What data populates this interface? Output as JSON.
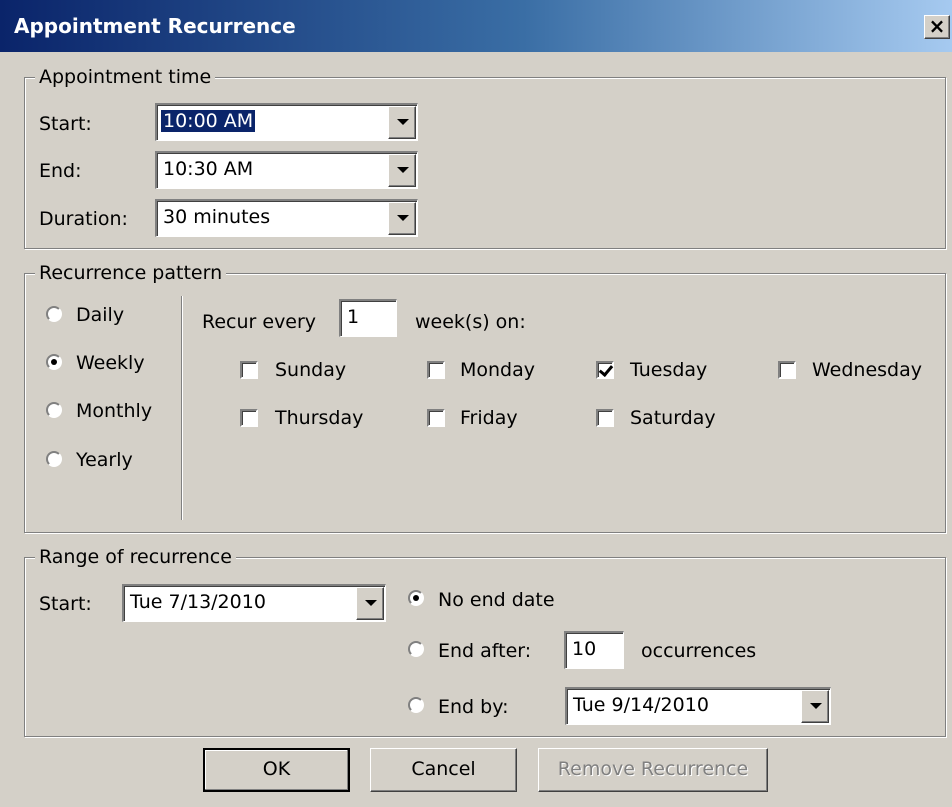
{
  "window": {
    "title": "Appointment Recurrence",
    "close_glyph": "×"
  },
  "appointment_time": {
    "legend": "Appointment time",
    "start_label": "Start:",
    "start_value": "10:00 AM",
    "end_label": "End:",
    "end_value": "10:30 AM",
    "duration_label": "Duration:",
    "duration_value": "30 minutes"
  },
  "recurrence_pattern": {
    "legend": "Recurrence pattern",
    "options": [
      "Daily",
      "Weekly",
      "Monthly",
      "Yearly"
    ],
    "selected": "Weekly",
    "recur_every_label": "Recur every",
    "recur_every_value": "1",
    "weeks_on_label": "week(s) on:",
    "days": [
      {
        "label": "Sunday",
        "checked": false
      },
      {
        "label": "Monday",
        "checked": false
      },
      {
        "label": "Tuesday",
        "checked": true
      },
      {
        "label": "Wednesday",
        "checked": false
      },
      {
        "label": "Thursday",
        "checked": false
      },
      {
        "label": "Friday",
        "checked": false
      },
      {
        "label": "Saturday",
        "checked": false
      }
    ]
  },
  "range": {
    "legend": "Range of recurrence",
    "start_label": "Start:",
    "start_value": "Tue 7/13/2010",
    "no_end_label": "No end date",
    "end_after_label": "End after:",
    "end_after_value": "10",
    "occurrences_label": "occurrences",
    "end_by_label": "End by:",
    "end_by_value": "Tue 9/14/2010",
    "selected": "No end date"
  },
  "buttons": {
    "ok": "OK",
    "cancel": "Cancel",
    "remove": "Remove Recurrence"
  }
}
